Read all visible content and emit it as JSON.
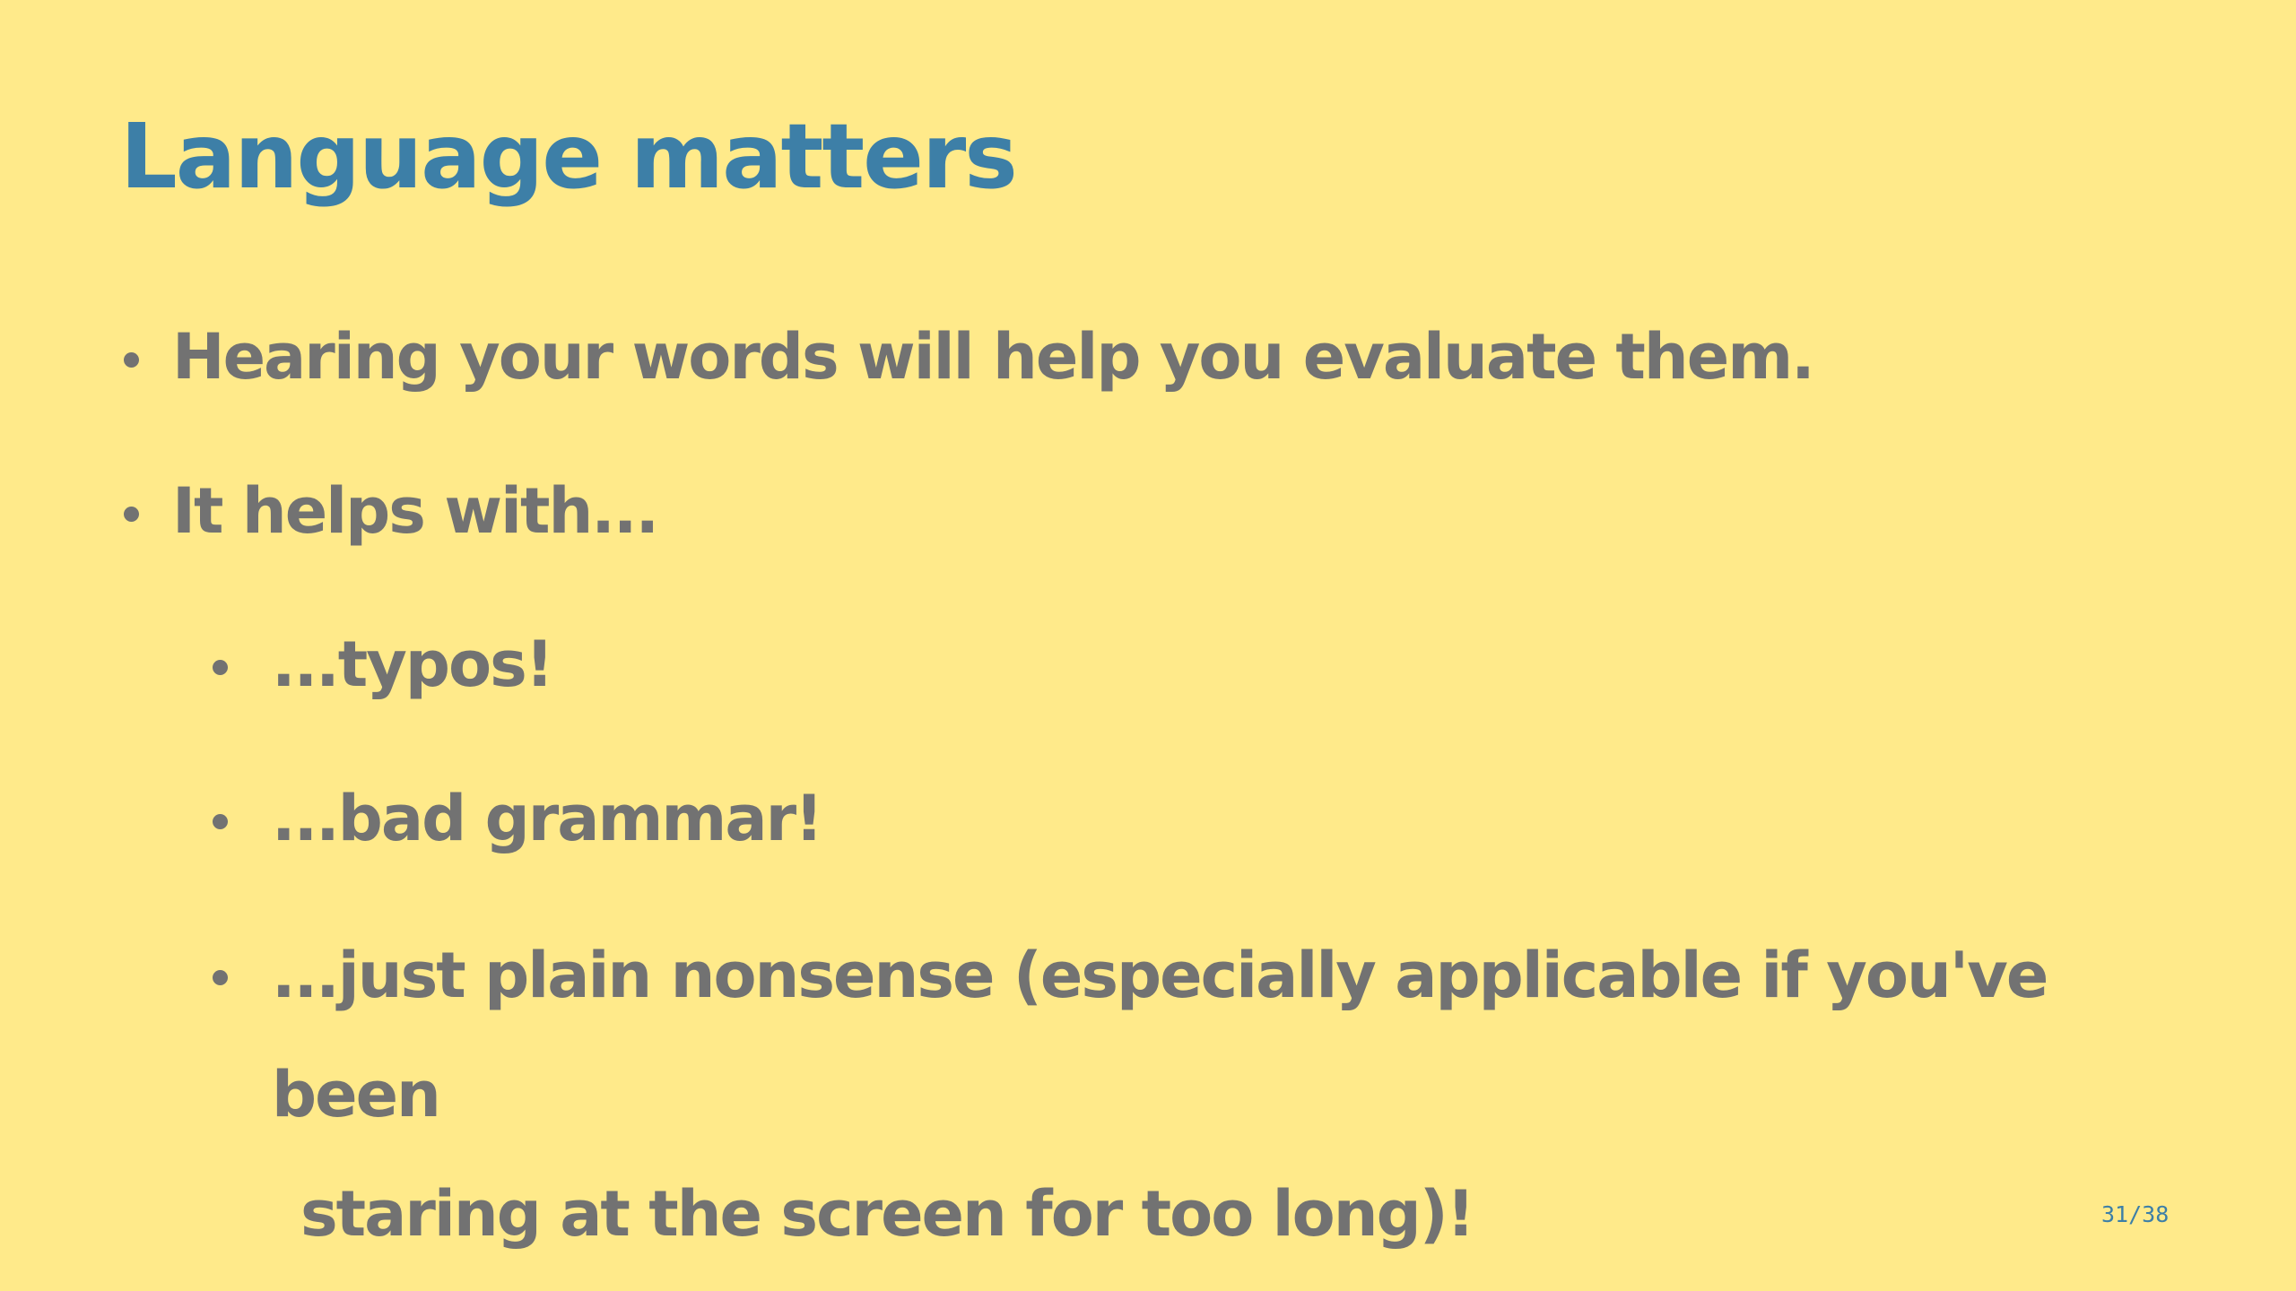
{
  "slide": {
    "title": "Language matters",
    "bullets": [
      {
        "text": "Hearing your words will help you evaluate them.",
        "level": 1
      },
      {
        "text": "It helps with...",
        "level": 1
      },
      {
        "text": "...typos!",
        "level": 2
      },
      {
        "text": "...bad grammar!",
        "level": 2
      },
      {
        "line1": "...just plain nonsense (especially applicable if you've been",
        "line2": "staring at the screen for too long)!",
        "level": 2
      }
    ],
    "page_number": "31/38"
  },
  "colors": {
    "background": "#ffea8a",
    "title": "#3d7fa7",
    "body_text": "#727272",
    "page_number": "#3d7fa7"
  }
}
